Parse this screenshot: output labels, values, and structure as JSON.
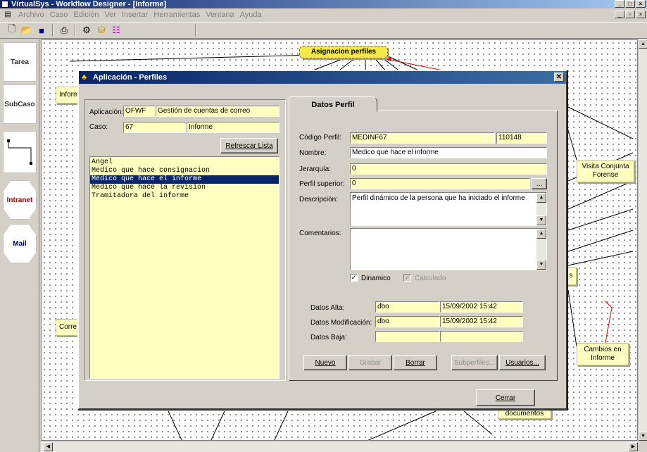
{
  "window": {
    "title": "VirtualSys - Workflow Designer - [Informe]"
  },
  "menu": [
    "Archivo",
    "Caso",
    "Edición",
    "Ver",
    "Insertar",
    "Herramientas",
    "Ventana",
    "Ayuda"
  ],
  "palette": [
    "Tarea",
    "SubCaso",
    "Intranet",
    "Mail"
  ],
  "canvas_nodes": {
    "asignacion": "Asignacion perfiles",
    "informe": "Inform",
    "correo": "Corre",
    "visita": "Visita Conjunta Forense",
    "s": "s",
    "cambios": "Cambios en Informe",
    "documentos": "documentos"
  },
  "dialog": {
    "title": "Aplicación - Perfiles",
    "aplicacion_label": "Aplicación:",
    "aplicacion_code": "OFWF",
    "aplicacion_name": "Gestión de cuentas de correo",
    "caso_label": "Caso:",
    "caso_code": "67",
    "caso_name": "Informe",
    "refresh_button": "Refrescar Lista",
    "profiles": [
      "Angel",
      "Medico que hace consignacion",
      "Medico que hace el informe",
      "Medico que hace la revision",
      "Tramitadora del informe"
    ],
    "selected_profile_index": 2,
    "tab_label": "Datos Perfil",
    "codigo_label": "Código Perfil:",
    "codigo_value": "MEDINF67",
    "codigo_num": "110148",
    "nombre_label": "Nombre:",
    "nombre_value": "Medico que hace el informe",
    "jerarquia_label": "Jerarquía:",
    "jerarquia_value": "0",
    "perfil_sup_label": "Perfil superior:",
    "perfil_sup_value": "0",
    "ellipsis": "...",
    "descripcion_label": "Descripción:",
    "descripcion_value": "Perfil dinámico de la persona que ha iniciado el informe",
    "comentarios_label": "Comentarios:",
    "comentarios_value": "",
    "dinamico_label": "Dinamico",
    "dinamico_checked": true,
    "calculado_label": "Calculado",
    "calculado_checked": true,
    "alta_label": "Datos Alta:",
    "alta_user": "dbo",
    "alta_date": "15/09/2002 15:42",
    "mod_label": "Datos Modificación:",
    "mod_user": "dbo",
    "mod_date": "15/09/2002 15:42",
    "baja_label": "Datos Baja:",
    "baja_user": "",
    "baja_date": "",
    "buttons": {
      "nuevo": "Nuevo",
      "grabar": "Grabar",
      "borrar": "Borrar",
      "subperfiles": "Subperfiles...",
      "usuarios": "Usuarios...",
      "cerrar": "Cerrar"
    }
  }
}
